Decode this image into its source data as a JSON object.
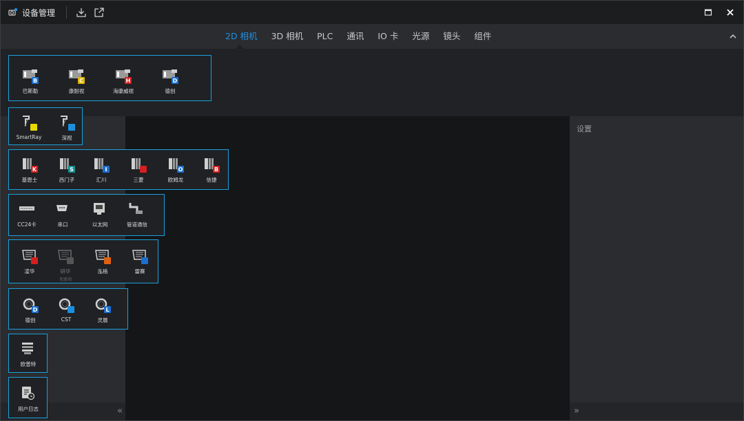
{
  "app": {
    "title": "设备管理",
    "icon": "camera-gear-icon",
    "toolbar": [
      {
        "name": "import-button",
        "icon": "download-tray-icon"
      },
      {
        "name": "export-button",
        "icon": "external-link-icon"
      }
    ],
    "window_buttons": [
      {
        "name": "maximize-button",
        "icon": "maximize-icon"
      },
      {
        "name": "close-button",
        "icon": "close-icon"
      }
    ]
  },
  "tabs": [
    {
      "label": "2D 相机",
      "active": true
    },
    {
      "label": "3D 相机",
      "active": false
    },
    {
      "label": "PLC",
      "active": false
    },
    {
      "label": "通讯",
      "active": false
    },
    {
      "label": "IO 卡",
      "active": false
    },
    {
      "label": "光源",
      "active": false
    },
    {
      "label": "镜头",
      "active": false
    },
    {
      "label": "组件",
      "active": false
    }
  ],
  "right_panel": {
    "title": "设置"
  },
  "colors": {
    "accent": "#1e90e8",
    "group_border": "#1aa1e0"
  },
  "groups": [
    {
      "name": "2d-camera-group",
      "items": [
        {
          "label": "巴斯勒",
          "icon": "camera-basler-icon",
          "badge": "B",
          "badge_color": "#1a6fd0"
        },
        {
          "label": "康耐视",
          "icon": "camera-cognex-icon",
          "badge": "C",
          "badge_color": "#e0b400"
        },
        {
          "label": "海康威视",
          "icon": "camera-hikvision-icon",
          "badge": "H",
          "badge_color": "#d42020"
        },
        {
          "label": "德创",
          "icon": "camera-dechuang-icon",
          "badge": "D",
          "badge_color": "#1a6fd0"
        }
      ]
    },
    {
      "name": "3d-camera-group",
      "items": [
        {
          "label": "SmartRay",
          "icon": "laser-sensor-smartray-icon",
          "badge": "",
          "badge_color": "#e8d800"
        },
        {
          "label": "深视",
          "icon": "laser-sensor-shenshi-icon",
          "badge": "",
          "badge_color": "#1a8fe0"
        }
      ]
    },
    {
      "name": "plc-group",
      "items": [
        {
          "label": "基恩士",
          "icon": "plc-keyence-icon",
          "badge": "K",
          "badge_color": "#d42020"
        },
        {
          "label": "西门子",
          "icon": "plc-siemens-icon",
          "badge": "S",
          "badge_color": "#139090"
        },
        {
          "label": "汇川",
          "icon": "plc-inovance-icon",
          "badge": "I",
          "badge_color": "#1a6fd0"
        },
        {
          "label": "三菱",
          "icon": "plc-mitsubishi-icon",
          "badge": "",
          "badge_color": "#d42020"
        },
        {
          "label": "欧姆龙",
          "icon": "plc-omron-icon",
          "badge": "O",
          "badge_color": "#1a6fd0"
        },
        {
          "label": "信捷",
          "icon": "plc-xinje-icon",
          "badge": "B",
          "badge_color": "#d42020"
        }
      ]
    },
    {
      "name": "communication-group",
      "items": [
        {
          "label": "CC24卡",
          "icon": "cc24-card-icon",
          "badge": "",
          "badge_color": ""
        },
        {
          "label": "串口",
          "icon": "serial-port-icon",
          "badge": "",
          "badge_color": ""
        },
        {
          "label": "以太网",
          "icon": "ethernet-icon",
          "badge": "",
          "badge_color": ""
        },
        {
          "label": "管道通信",
          "icon": "pipe-communication-icon",
          "badge": "",
          "badge_color": ""
        }
      ]
    },
    {
      "name": "io-card-group",
      "items": [
        {
          "label": "凌华",
          "icon": "io-card-adlink-icon",
          "badge": "",
          "badge_color": "#d42020",
          "disabled": false
        },
        {
          "label": "研华",
          "icon": "io-card-advantech-icon",
          "badge": "",
          "badge_color": "#555555",
          "disabled": true,
          "sublabel": "无驱动"
        },
        {
          "label": "泓格",
          "icon": "io-card-icpdas-icon",
          "badge": "",
          "badge_color": "#e06010",
          "disabled": false
        },
        {
          "label": "雷赛",
          "icon": "io-card-leadshine-icon",
          "badge": "",
          "badge_color": "#1a6fd0",
          "disabled": false
        }
      ]
    },
    {
      "name": "light-source-group",
      "items": [
        {
          "label": "德创",
          "icon": "light-ring-dechuang-icon",
          "badge": "D",
          "badge_color": "#1a6fd0"
        },
        {
          "label": "CST",
          "icon": "light-ring-cst-icon",
          "badge": "",
          "badge_color": "#1a8fe0"
        },
        {
          "label": "灵展",
          "icon": "light-ring-lingzhan-icon",
          "badge": "L",
          "badge_color": "#1a6fd0"
        }
      ]
    },
    {
      "name": "lens-group",
      "items": [
        {
          "label": "欧普特",
          "icon": "lens-opt-icon",
          "badge": "",
          "badge_color": ""
        }
      ]
    },
    {
      "name": "component-group",
      "items": [
        {
          "label": "用户日志",
          "icon": "user-log-icon",
          "badge": "",
          "badge_color": ""
        }
      ]
    }
  ]
}
